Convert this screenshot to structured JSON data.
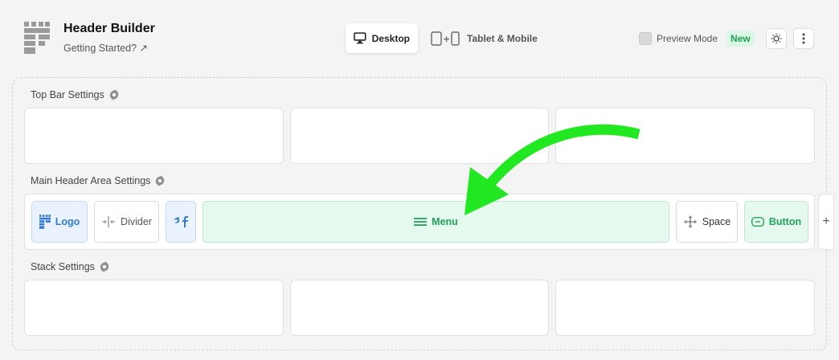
{
  "header": {
    "title": "Header Builder",
    "subtitle": "Getting Started? ↗"
  },
  "devices": {
    "desktop_label": "Desktop",
    "tablet_label": "Tablet & Mobile"
  },
  "toolbar": {
    "preview_label": "Preview Mode",
    "new_badge": "New"
  },
  "sections": {
    "top_bar": "Top Bar Settings",
    "main_header": "Main Header Area Settings",
    "stack": "Stack Settings"
  },
  "main_row": {
    "logo": "Logo",
    "divider": "Divider",
    "menu": "Menu",
    "space": "Space",
    "button": "Button"
  },
  "colors": {
    "accent_green": "#22a35a",
    "accent_blue": "#2f7ad6",
    "arrow_green": "#22e822"
  }
}
